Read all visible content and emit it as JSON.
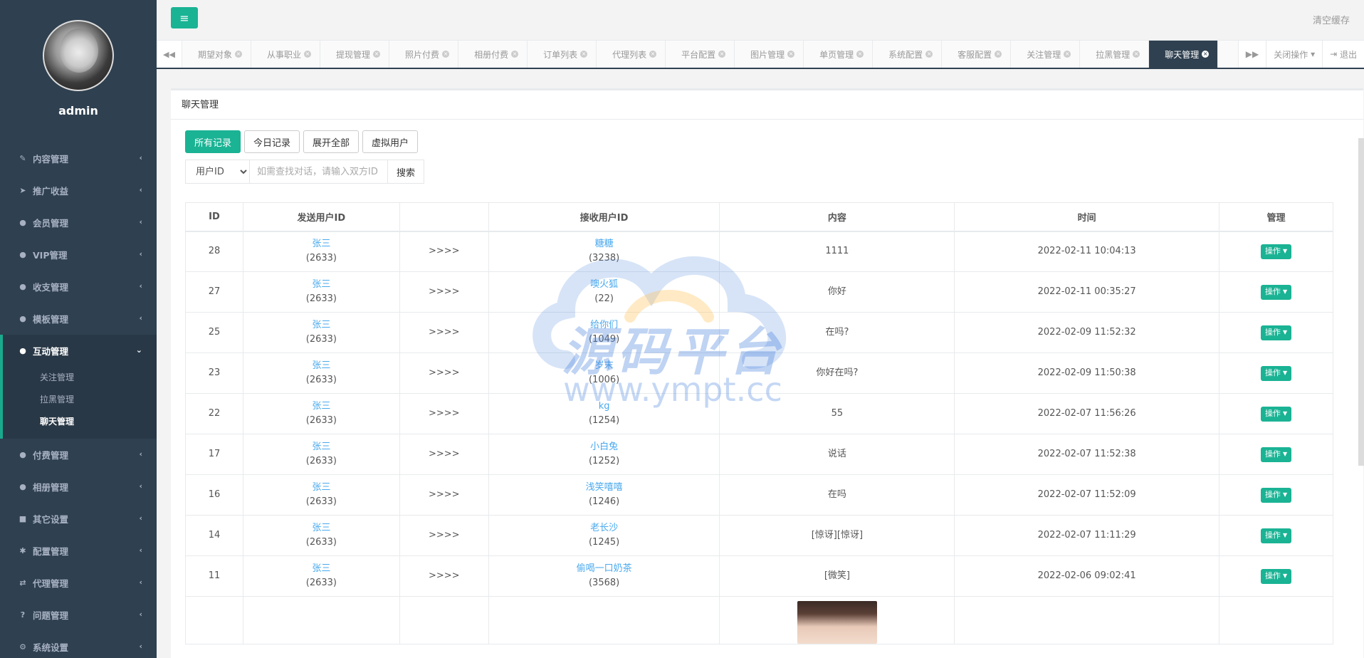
{
  "user": {
    "name": "admin"
  },
  "sidebar": {
    "items": [
      {
        "label": "内容管理",
        "icon": "edit-icon"
      },
      {
        "label": "推广收益",
        "icon": "send-icon"
      },
      {
        "label": "会员管理",
        "icon": "user-icon"
      },
      {
        "label": "VIP管理",
        "icon": "user-icon"
      },
      {
        "label": "收支管理",
        "icon": "user-icon"
      },
      {
        "label": "模板管理",
        "icon": "user-icon"
      }
    ],
    "active": {
      "label": "互动管理",
      "icon": "user-icon",
      "children": [
        "关注管理",
        "拉黑管理",
        "聊天管理"
      ],
      "active_child": "聊天管理"
    },
    "items_after": [
      {
        "label": "付费管理",
        "icon": "user-icon"
      },
      {
        "label": "相册管理",
        "icon": "user-icon"
      },
      {
        "label": "其它设置",
        "icon": "book-icon"
      },
      {
        "label": "配置管理",
        "icon": "gear-icon"
      },
      {
        "label": "代理管理",
        "icon": "exchange-icon"
      },
      {
        "label": "问题管理",
        "icon": "question-icon"
      },
      {
        "label": "系统设置",
        "icon": "gears-icon"
      }
    ]
  },
  "topbar": {
    "clear_cache": "清空缓存"
  },
  "tabs": {
    "items": [
      "期望对象",
      "从事职业",
      "提现管理",
      "照片付费",
      "相册付费",
      "订单列表",
      "代理列表",
      "平台配置",
      "图片管理",
      "单页管理",
      "系统配置",
      "客服配置",
      "关注管理",
      "拉黑管理",
      "聊天管理"
    ],
    "active": "聊天管理",
    "close_ops": "关闭操作",
    "logout": "退出"
  },
  "panel": {
    "title": "聊天管理",
    "buttons": {
      "all": "所有记录",
      "today": "今日记录",
      "expand": "展开全部",
      "virtual": "虚拟用户"
    },
    "search": {
      "select_value": "用户ID",
      "placeholder": "如需查找对话，请输入双方ID",
      "button": "搜索"
    },
    "table": {
      "headers": [
        "ID",
        "发送用户ID",
        "",
        "接收用户ID",
        "内容",
        "时间",
        "管理"
      ],
      "rows": [
        {
          "id": "28",
          "sender": "张三",
          "sender_id": "(2633)",
          "arrow": ">>>>",
          "receiver": "糖糖",
          "receiver_id": "(3238)",
          "content": "1111",
          "time": "2022-02-11 10:04:13",
          "op": "操作"
        },
        {
          "id": "27",
          "sender": "张三",
          "sender_id": "(2633)",
          "arrow": ">>>>",
          "receiver": "噢火狐",
          "receiver_id": "(22)",
          "content": "你好",
          "time": "2022-02-11 00:35:27",
          "op": "操作"
        },
        {
          "id": "25",
          "sender": "张三",
          "sender_id": "(2633)",
          "arrow": ">>>>",
          "receiver": "给你们",
          "receiver_id": "(1049)",
          "content": "在吗?",
          "time": "2022-02-09 11:52:32",
          "op": "操作"
        },
        {
          "id": "23",
          "sender": "张三",
          "sender_id": "(2633)",
          "arrow": ">>>>",
          "receiver": "岁末",
          "receiver_id": "(1006)",
          "content": "你好在吗?",
          "time": "2022-02-09 11:50:38",
          "op": "操作"
        },
        {
          "id": "22",
          "sender": "张三",
          "sender_id": "(2633)",
          "arrow": ">>>>",
          "receiver": "kg",
          "receiver_id": "(1254)",
          "content": "55",
          "time": "2022-02-07 11:56:26",
          "op": "操作"
        },
        {
          "id": "17",
          "sender": "张三",
          "sender_id": "(2633)",
          "arrow": ">>>>",
          "receiver": "小白兔",
          "receiver_id": "(1252)",
          "content": "说话",
          "time": "2022-02-07 11:52:38",
          "op": "操作"
        },
        {
          "id": "16",
          "sender": "张三",
          "sender_id": "(2633)",
          "arrow": ">>>>",
          "receiver": "浅笑嘻嘻",
          "receiver_id": "(1246)",
          "content": "在吗",
          "time": "2022-02-07 11:52:09",
          "op": "操作"
        },
        {
          "id": "14",
          "sender": "张三",
          "sender_id": "(2633)",
          "arrow": ">>>>",
          "receiver": "老长沙",
          "receiver_id": "(1245)",
          "content": "[惊讶][惊讶]",
          "time": "2022-02-07 11:11:29",
          "op": "操作"
        },
        {
          "id": "11",
          "sender": "张三",
          "sender_id": "(2633)",
          "arrow": ">>>>",
          "receiver": "偷喝一口奶茶",
          "receiver_id": "(3568)",
          "content": "[微笑]",
          "time": "2022-02-06 09:02:41",
          "op": "操作"
        }
      ]
    }
  },
  "watermark": {
    "title": "源码平台",
    "url": "www.ympt.cc"
  },
  "colors": {
    "sidebar": "#2f4050",
    "accent": "#1ab394",
    "link": "#49a9ee"
  }
}
